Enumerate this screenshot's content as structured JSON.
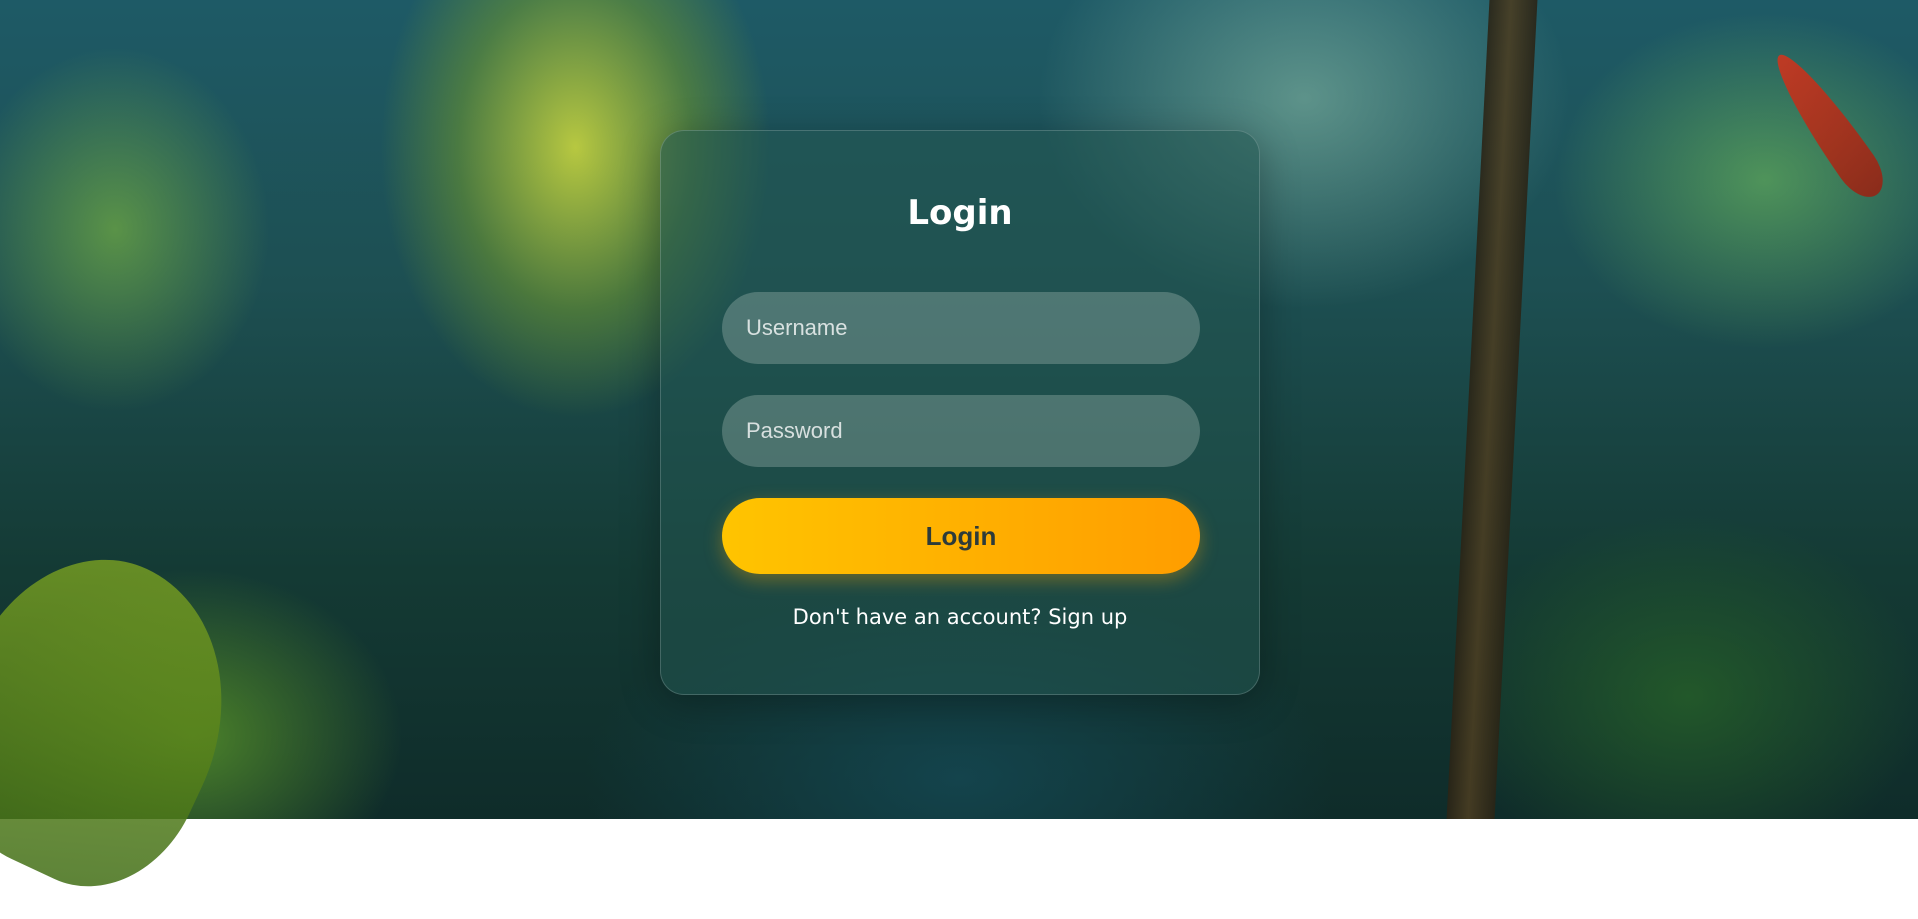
{
  "login_card": {
    "title": "Login",
    "username": {
      "placeholder": "Username",
      "value": ""
    },
    "password": {
      "placeholder": "Password",
      "value": ""
    },
    "submit_label": "Login",
    "signup_prompt": "Don't have an account?",
    "signup_link": "Sign up"
  },
  "colors": {
    "button_gradient_start": "#ffc400",
    "button_gradient_end": "#ff9d00",
    "button_text": "#2d3b3a",
    "text": "#ffffff"
  }
}
